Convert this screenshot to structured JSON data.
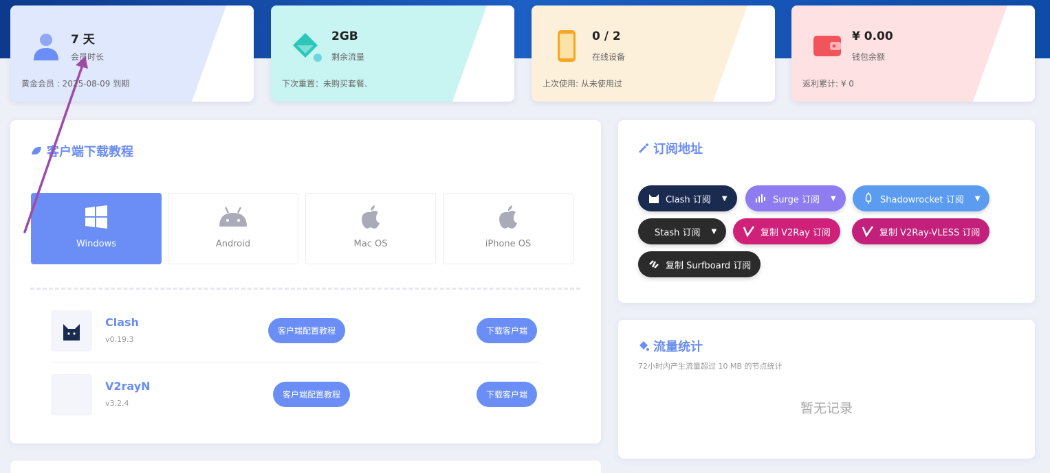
{
  "stats": [
    {
      "value": "7 天",
      "label": "会员时长",
      "foot": "黄金会员 : 2025-08-09 到期",
      "icon": "user-icon"
    },
    {
      "value": "2GB",
      "label": "剩余流量",
      "foot": "下次重置：未购买套餐.",
      "icon": "water-bucket-icon"
    },
    {
      "value": "0 / 2",
      "label": "在线设备",
      "foot": "上次使用: 从未使用过",
      "icon": "phone-icon"
    },
    {
      "value": "¥ 0.00",
      "label": "钱包余额",
      "foot": "返利累计: ¥ 0",
      "icon": "wallet-icon"
    }
  ],
  "download": {
    "title": "客户端下载教程",
    "os_tabs": [
      "Windows",
      "Android",
      "Mac OS",
      "iPhone OS"
    ],
    "clients": [
      {
        "name": "Clash",
        "version": "v0.19.3",
        "tutorial": "客户端配置教程",
        "download": "下载客户端"
      },
      {
        "name": "V2rayN",
        "version": "v3.2.4",
        "tutorial": "客户端配置教程",
        "download": "下载客户端"
      }
    ]
  },
  "subscribe": {
    "title": "订阅地址",
    "buttons": [
      {
        "label": "Clash 订阅",
        "color": "#1a2b4f",
        "has_menu": true,
        "icon": "clash-cat-icon"
      },
      {
        "label": "Surge 订阅",
        "color": "#8f7cf0",
        "has_menu": true,
        "icon": "surge-bars-icon"
      },
      {
        "label": "Shadowrocket 订阅",
        "color": "#5b9cf0",
        "has_menu": true,
        "icon": "rocket-icon"
      },
      {
        "label": "Stash 订阅",
        "color": "#2b2b2b",
        "has_menu": true,
        "icon": ""
      },
      {
        "label": "复制 V2Ray 订阅",
        "color": "#d0217a",
        "has_menu": false,
        "icon": "v2ray-icon"
      },
      {
        "label": "复制 V2Ray-VLESS 订阅",
        "color": "#c2207a",
        "has_menu": false,
        "icon": "v2ray-icon"
      },
      {
        "label": "复制 Surfboard 订阅",
        "color": "#2b2b2b",
        "has_menu": false,
        "icon": "surfboard-icon"
      }
    ]
  },
  "traffic": {
    "title": "流量统计",
    "note": "72小时内产生流量超过 10 MB 的节点统计",
    "empty": "暂无记录"
  },
  "colors": {
    "accent": "#6a8ef5",
    "title": "#6a8df0",
    "annotation_arrow": "#a04aa8"
  }
}
